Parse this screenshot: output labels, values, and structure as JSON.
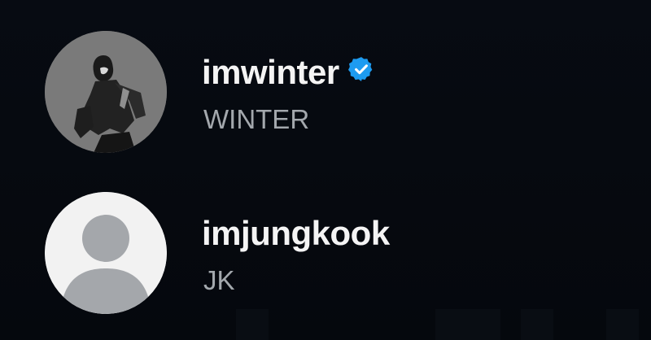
{
  "accounts": [
    {
      "username": "imwinter",
      "display_name": "WINTER",
      "verified": true,
      "avatar": "profile-photo",
      "verified_icon": "verified-badge-icon"
    },
    {
      "username": "imjungkook",
      "display_name": "JK",
      "verified": false,
      "avatar": "default-avatar-icon"
    }
  ],
  "colors": {
    "background": "#060a10",
    "username": "#f4f4f4",
    "display_name": "#a3a8ad",
    "verified_badge": "#1d9bf0"
  }
}
